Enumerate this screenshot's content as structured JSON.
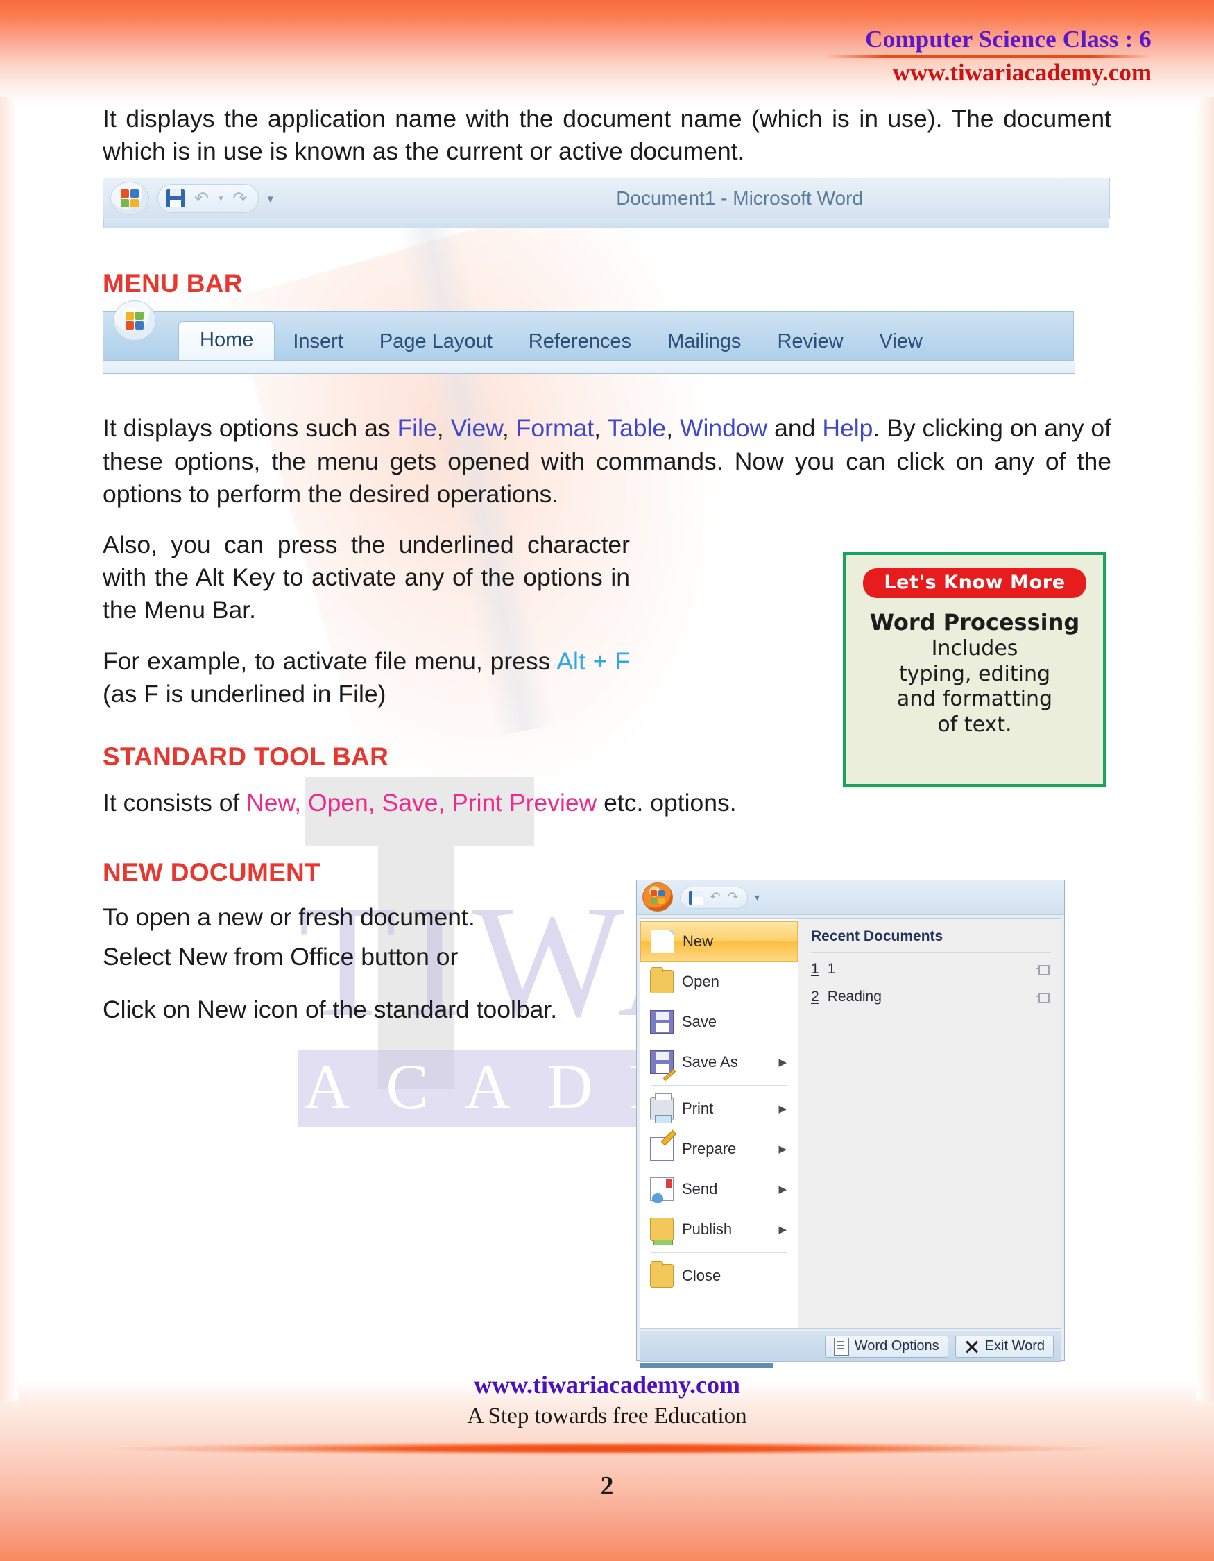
{
  "header": {
    "title": "Computer Science Class : 6",
    "url": "www.tiwariacademy.com"
  },
  "intro": {
    "paragraph": "It displays the application name with the document name (which is in use). The document which is in use is known as the current or active document."
  },
  "word_titlebar": {
    "document_title": "Document1 - Microsoft Word",
    "save_tooltip": "Save",
    "undo_glyph": "↶",
    "redo_glyph": "↷",
    "customize_glyph": "▾"
  },
  "menu_bar_section": {
    "heading": "MENU BAR",
    "tabs": [
      "Home",
      "Insert",
      "Page Layout",
      "References",
      "Mailings",
      "Review",
      "View"
    ],
    "active_tab": "Home",
    "paragraph_1_lead": "It displays options such as ",
    "options": [
      "File",
      "View",
      "Format",
      "Table",
      "Window"
    ],
    "paragraph_1_mid": " and ",
    "option_last": "Help",
    "paragraph_1_tail": ". By clicking on any of these options, the menu gets opened with commands. Now you can click on any of the options to perform the desired operations.",
    "paragraph_2": "Also, you can press the underlined character with the Alt Key to activate any of the options in the Menu Bar.",
    "paragraph_3_lead": "For example, to activate file menu, press ",
    "shortcut": "Alt + F",
    "paragraph_3_tail": " (as F is underlined in File)"
  },
  "know_more_box": {
    "badge": "Let's Know More",
    "line_1": "Word Processing",
    "line_2": "Includes",
    "line_3": "typing, editing",
    "line_4": "and formatting",
    "line_5": "of text.",
    "border_color": "#18a558",
    "background_color": "#eaeeda",
    "badge_color": "#e71d1d"
  },
  "standard_toolbar_section": {
    "heading": "STANDARD TOOL BAR",
    "lead": "It consists of ",
    "items": "New, Open, Save, Print Preview",
    "tail": " etc. options."
  },
  "new_document_section": {
    "heading": "NEW DOCUMENT",
    "line_1": "To open a new or fresh document.",
    "line_2": "Select New from Office button or",
    "line_3": "Click on New icon of the standard toolbar."
  },
  "office_menu": {
    "left_items": [
      {
        "label": "New",
        "icon": "new-document-icon",
        "selected": true,
        "has_submenu": false
      },
      {
        "label": "Open",
        "icon": "open-folder-icon",
        "selected": false,
        "has_submenu": false
      },
      {
        "label": "Save",
        "icon": "floppy-disk-icon",
        "selected": false,
        "has_submenu": false
      },
      {
        "label": "Save As",
        "icon": "save-as-icon",
        "selected": false,
        "has_submenu": true
      },
      {
        "label": "Print",
        "icon": "printer-icon",
        "selected": false,
        "has_submenu": true
      },
      {
        "label": "Prepare",
        "icon": "prepare-document-icon",
        "selected": false,
        "has_submenu": true
      },
      {
        "label": "Send",
        "icon": "send-envelope-icon",
        "selected": false,
        "has_submenu": true
      },
      {
        "label": "Publish",
        "icon": "publish-folder-icon",
        "selected": false,
        "has_submenu": true
      },
      {
        "label": "Close",
        "icon": "close-folder-icon",
        "selected": false,
        "has_submenu": false
      }
    ],
    "recent_title": "Recent Documents",
    "recent_documents": [
      {
        "num": "1",
        "name": "1"
      },
      {
        "num": "2",
        "name": "Reading"
      }
    ],
    "word_options_button": "Word Options",
    "exit_word_button": "Exit Word",
    "submenu_arrow": "▶"
  },
  "watermark": {
    "line_1": "TIWARI",
    "line_2": "ACADEMY"
  },
  "footer": {
    "url": "www.tiwariacademy.com",
    "tagline": "A Step towards free Education",
    "page_number": "2"
  },
  "colors": {
    "heading_red": "#e8372f",
    "link_blue": "#3f48cc",
    "shortcut_cyan": "#2fa8e8",
    "toolbar_pink": "#ee2a8c",
    "header_purple": "#5a18c8",
    "header_red": "#d01111",
    "band_orange": "#fa6a3c"
  }
}
